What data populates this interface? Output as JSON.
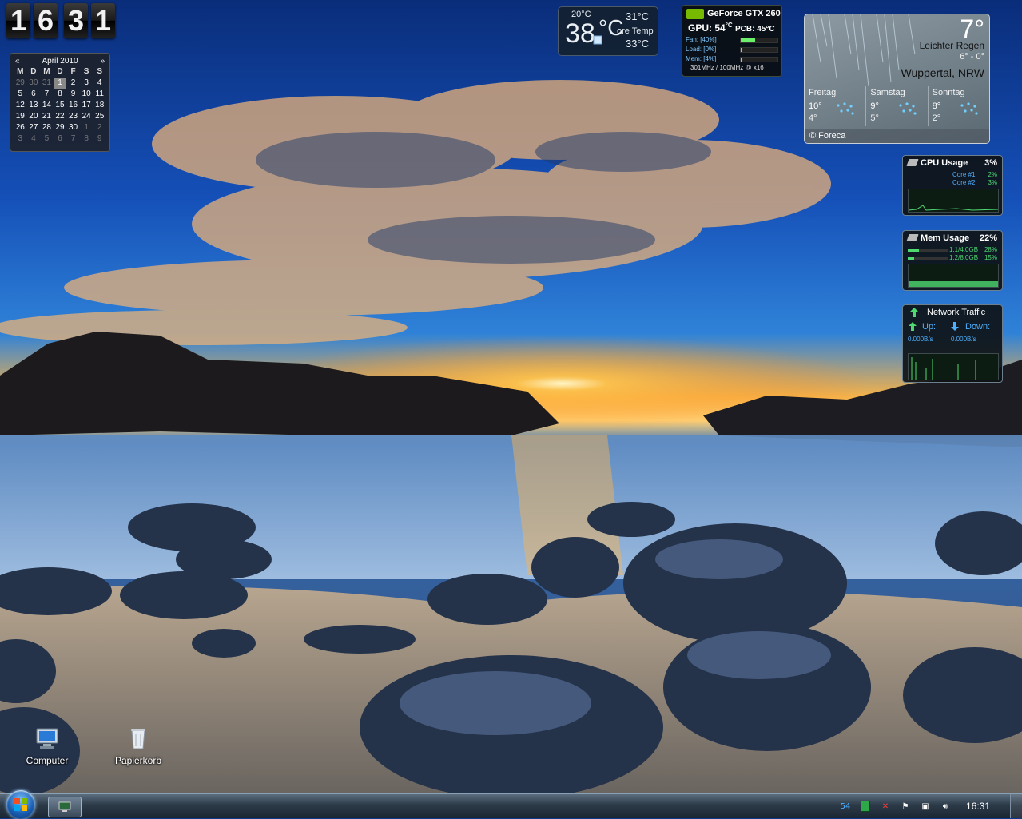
{
  "clock": {
    "digits": [
      "1",
      "6",
      "3",
      "1"
    ]
  },
  "calendar": {
    "month_year": "April 2010",
    "prev": "«",
    "next": "»",
    "weekdays": [
      "M",
      "D",
      "M",
      "D",
      "F",
      "S",
      "S"
    ],
    "weeks": [
      [
        "29",
        "30",
        "31",
        "1",
        "2",
        "3",
        "4"
      ],
      [
        "5",
        "6",
        "7",
        "8",
        "9",
        "10",
        "11"
      ],
      [
        "12",
        "13",
        "14",
        "15",
        "16",
        "17",
        "18"
      ],
      [
        "19",
        "20",
        "21",
        "22",
        "23",
        "24",
        "25"
      ],
      [
        "26",
        "27",
        "28",
        "29",
        "30",
        "1",
        "2"
      ],
      [
        "3",
        "4",
        "5",
        "6",
        "7",
        "8",
        "9"
      ]
    ],
    "today": "1"
  },
  "core_temp": {
    "main": "38",
    "unit": "°C",
    "top_left": "20°C",
    "top_right": "31°C",
    "label": "ore Temp",
    "bottom_right": "33°C"
  },
  "gpu": {
    "name": "GeForce GTX 260",
    "gpu_temp": "GPU: 54",
    "gpu_temp_unit": "°C",
    "pcb_temp": "PCB: 45°C",
    "fan": "Fan: [40%]",
    "fan_pct": 40,
    "load": "Load: [0%]",
    "load_pct": 0,
    "mem": "Mem: [4%]",
    "mem_pct": 4,
    "clock": "301MHz / 100MHz @ x16"
  },
  "weather": {
    "temp": "7°",
    "condition": "Leichter Regen",
    "range": "6° - 0°",
    "city": "Wuppertal, NRW",
    "days": [
      {
        "name": "Freitag",
        "high": "10°",
        "low": "4°"
      },
      {
        "name": "Samstag",
        "high": "9°",
        "low": "5°"
      },
      {
        "name": "Sonntag",
        "high": "8°",
        "low": "2°"
      }
    ],
    "footer": "© Foreca"
  },
  "cpu": {
    "title": "CPU Usage",
    "pct": "3%",
    "cores": [
      {
        "name": "Core #1",
        "value": "2%"
      },
      {
        "name": "Core #2",
        "value": "3%"
      }
    ]
  },
  "mem": {
    "title": "Mem Usage",
    "pct": "22%",
    "rows": [
      {
        "name": "1.1/4.0GB",
        "value": "28%"
      },
      {
        "name": "1.2/8.0GB",
        "value": "15%"
      }
    ]
  },
  "network": {
    "title": "Network Traffic",
    "up_label": "Up:",
    "down_label": "Down:",
    "up_value": "0.000B/s",
    "down_value": "0.000B/s"
  },
  "desktop_icons": [
    {
      "label": "Computer"
    },
    {
      "label": "Papierkorb"
    }
  ],
  "taskbar": {
    "tray_number": "54",
    "time": "16:31"
  },
  "colors": {
    "accent_green": "#4fd870",
    "nvidia_green": "#76b900",
    "info_blue": "#4fb0ff"
  }
}
